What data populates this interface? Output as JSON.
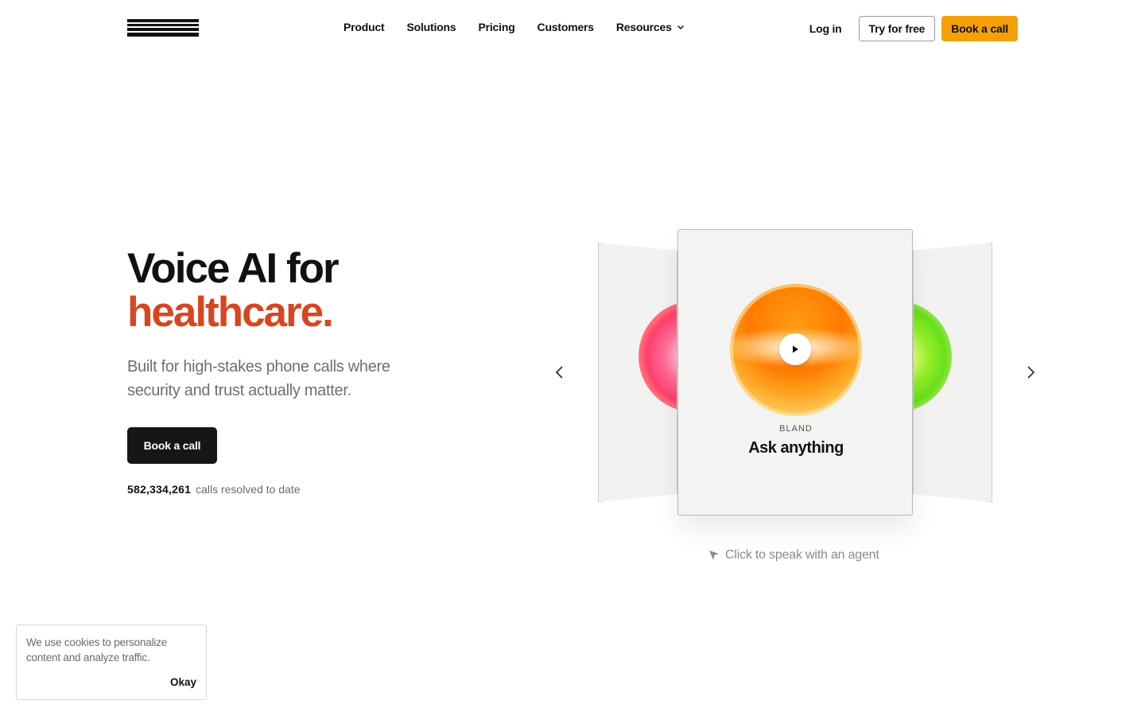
{
  "nav": {
    "logo_alt": "bland",
    "links": [
      {
        "label": "Product"
      },
      {
        "label": "Solutions"
      },
      {
        "label": "Pricing"
      },
      {
        "label": "Customers"
      },
      {
        "label": "Resources"
      }
    ],
    "login": "Log in",
    "try_free": "Try for free",
    "book_call": "Book a call"
  },
  "hero": {
    "title_line1": "Voice AI for",
    "title_accent": "healthcare.",
    "subtitle": "Built for high-stakes phone calls where security and trust actually matter.",
    "cta": "Book a call",
    "stat_number": "582,334,261",
    "stat_label": "calls resolved to date"
  },
  "carousel": {
    "card_kicker": "BLAND",
    "card_title": "Ask anything",
    "hint": "Click to speak with an agent"
  },
  "cookie": {
    "text": "We use cookies to personalize content and analyze traffic.",
    "okay": "Okay"
  },
  "colors": {
    "accent": "#d7461f",
    "cta_yellow": "#f5a00b",
    "dark_button": "#161616"
  }
}
